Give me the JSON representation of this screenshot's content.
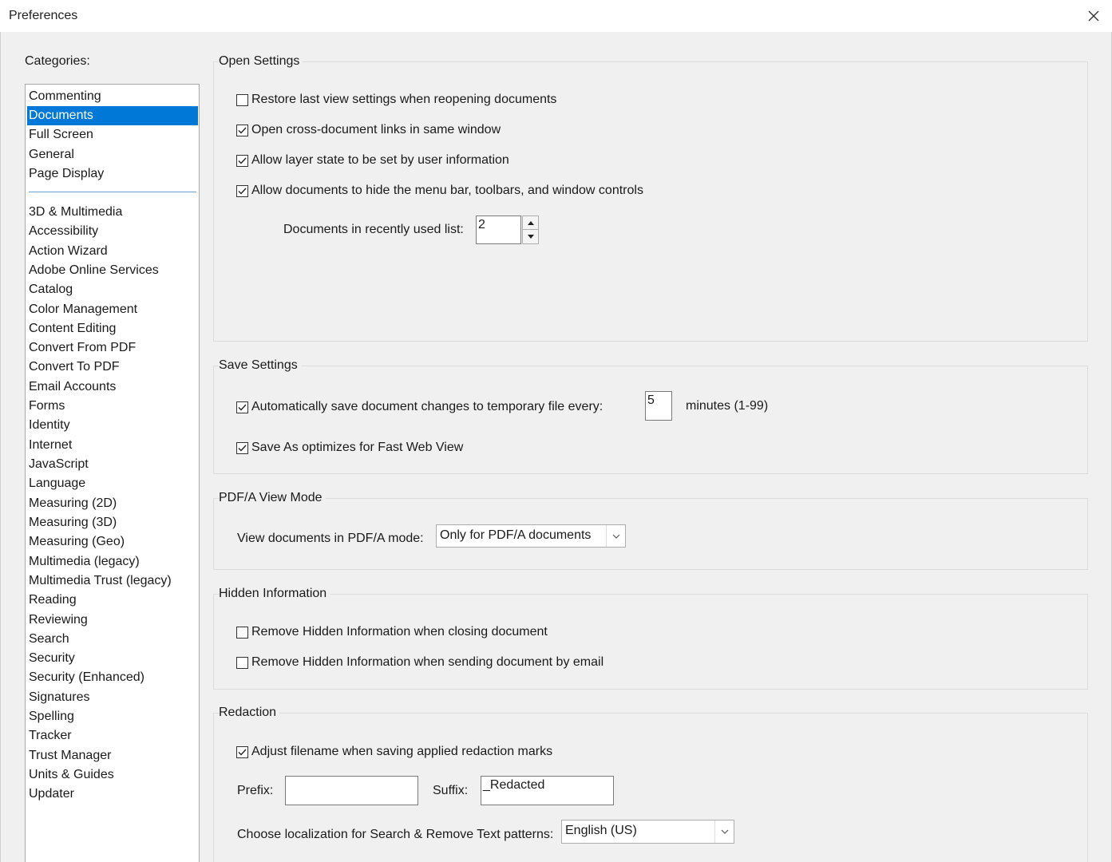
{
  "window": {
    "title": "Preferences"
  },
  "categories": {
    "label": "Categories:",
    "selected": "Documents",
    "top_items": [
      "Commenting",
      "Documents",
      "Full Screen",
      "General",
      "Page Display"
    ],
    "items": [
      "3D & Multimedia",
      "Accessibility",
      "Action Wizard",
      "Adobe Online Services",
      "Catalog",
      "Color Management",
      "Content Editing",
      "Convert From PDF",
      "Convert To PDF",
      "Email Accounts",
      "Forms",
      "Identity",
      "Internet",
      "JavaScript",
      "Language",
      "Measuring (2D)",
      "Measuring (3D)",
      "Measuring (Geo)",
      "Multimedia (legacy)",
      "Multimedia Trust (legacy)",
      "Reading",
      "Reviewing",
      "Search",
      "Security",
      "Security (Enhanced)",
      "Signatures",
      "Spelling",
      "Tracker",
      "Trust Manager",
      "Units & Guides",
      "Updater"
    ]
  },
  "open_settings": {
    "title": "Open Settings",
    "options": [
      {
        "label": "Restore last view settings when reopening documents",
        "checked": false
      },
      {
        "label": "Open cross-document links in same window",
        "checked": true
      },
      {
        "label": "Allow layer state to be set by user information",
        "checked": true
      },
      {
        "label": "Allow documents to hide the menu bar, toolbars, and window controls",
        "checked": true
      }
    ],
    "recent_label": "Documents in recently used list:",
    "recent_value": "2"
  },
  "save_settings": {
    "title": "Save Settings",
    "autosave_label": "Automatically save document changes to temporary file every:",
    "autosave_checked": true,
    "autosave_value": "5",
    "autosave_unit": "minutes (1-99)",
    "fastweb_label": "Save As optimizes for Fast Web View",
    "fastweb_checked": true
  },
  "pdfa": {
    "title": "PDF/A View Mode",
    "label": "View documents in PDF/A mode:",
    "selected": "Only for PDF/A documents"
  },
  "hidden_info": {
    "title": "Hidden Information",
    "options": [
      {
        "label": "Remove Hidden Information when closing document",
        "checked": false
      },
      {
        "label": "Remove Hidden Information when sending document by email",
        "checked": false
      }
    ]
  },
  "redaction": {
    "title": "Redaction",
    "adjust_label": "Adjust filename when saving applied redaction marks",
    "adjust_checked": true,
    "prefix_label": "Prefix:",
    "prefix_value": "",
    "suffix_label": "Suffix:",
    "suffix_value": "_Redacted",
    "locale_label": "Choose localization for Search & Remove Text patterns:",
    "locale_selected": "English (US)"
  }
}
